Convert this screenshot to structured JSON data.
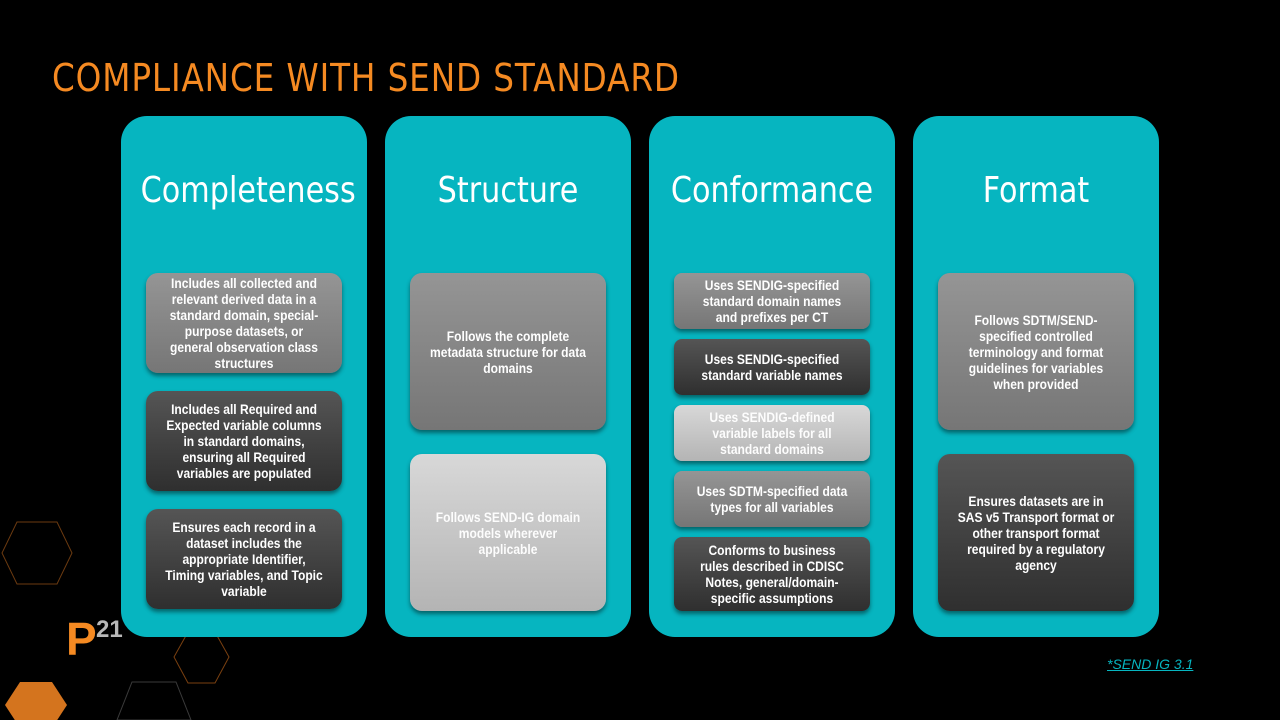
{
  "title": "COMPLIANCE WITH SEND STANDARD",
  "colors": {
    "accent": "#f58a22",
    "panel": "#06b5c0",
    "background": "#000000"
  },
  "panels": [
    {
      "heading": "Completeness",
      "items": [
        "Includes all collected and relevant derived data in a standard domain, special-purpose datasets, or general observation class structures",
        "Includes all Required and Expected variable columns in standard domains, ensuring all Required variables are populated",
        "Ensures each record in a dataset includes the appropriate Identifier, Timing variables, and Topic variable"
      ]
    },
    {
      "heading": "Structure",
      "items": [
        "Follows the complete metadata structure for data domains",
        "Follows SEND-IG domain models wherever applicable"
      ]
    },
    {
      "heading": "Conformance",
      "items": [
        "Uses SENDIG-specified standard domain names and prefixes per CT",
        "Uses SENDIG-specified standard variable names",
        "Uses SENDIG-defined variable labels for all standard domains",
        "Uses SDTM-specified data types for all variables",
        "Conforms to business rules described in CDISC Notes, general/domain-specific assumptions"
      ]
    },
    {
      "heading": "Format",
      "items": [
        "Follows SDTM/SEND-specified controlled terminology and format guidelines for variables when provided",
        "Ensures datasets are in SAS v5 Transport format or other transport format required by a regulatory agency"
      ]
    }
  ],
  "logo": {
    "letter": "P",
    "number": "21"
  },
  "reference_link": "*SEND IG 3.1"
}
